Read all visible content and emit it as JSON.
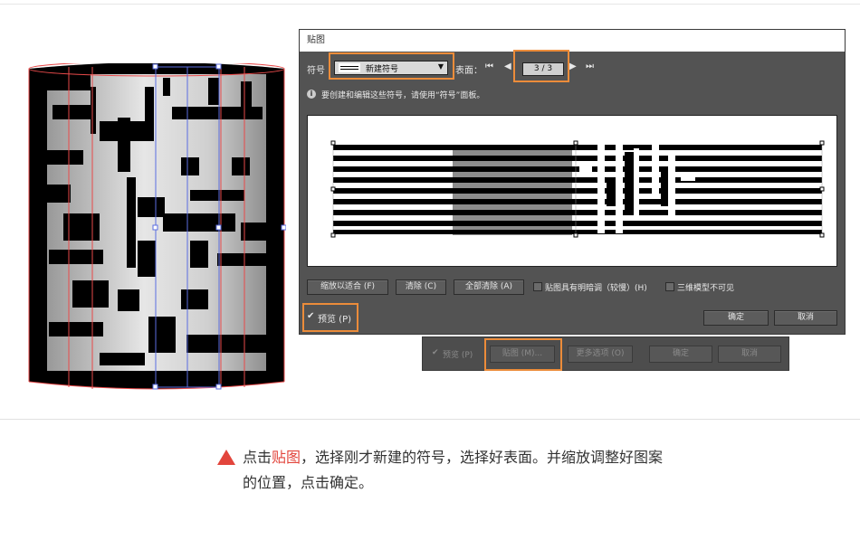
{
  "dialog": {
    "title": "贴图",
    "symbol_label": "符号",
    "symbol_value": "新建符号",
    "surface_label": "表面：",
    "surface_value": "3 / 3",
    "info_text": "要创建和编辑这些符号，请使用“符号”面板。",
    "buttons": {
      "scale_to_fit": "缩放以适合 (F)",
      "clear": "清除 (C)",
      "clear_all": "全部清除 (A)",
      "ok": "确定",
      "cancel": "取消"
    },
    "checkboxes": {
      "shade_artwork": "贴图具有明暗调（较慢）(H)",
      "invisible_geometry": "三维模型不可见",
      "preview": "预览 (P)"
    }
  },
  "lower_dialog": {
    "preview": "预览 (P)",
    "map_art": "贴图 (M)...",
    "more_options": "更多选项 (O)",
    "ok": "确定",
    "cancel": "取消"
  },
  "caption": {
    "prefix": "点击",
    "highlight": "贴图",
    "rest": "，选择刚才新建的符号，选择好表面。并缩放调整好图案的位置，点击确定。"
  },
  "colors": {
    "accent": "#ec8c3a",
    "caption_highlight": "#e2453c",
    "dialog_bg": "#535353"
  }
}
